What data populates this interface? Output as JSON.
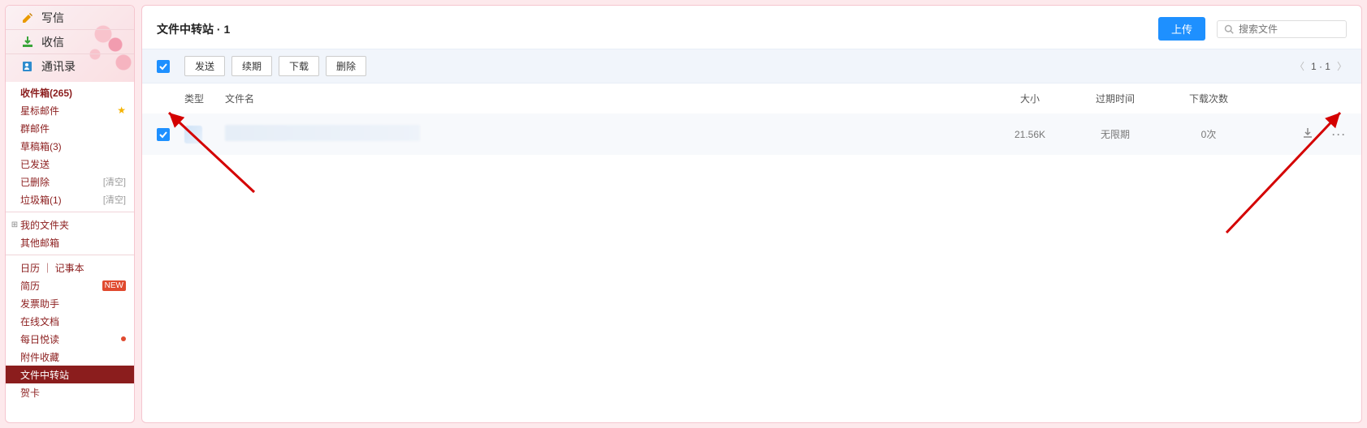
{
  "sidebar": {
    "top_items": [
      {
        "label": "写信",
        "icon": "compose-icon"
      },
      {
        "label": "收信",
        "icon": "inbox-icon"
      },
      {
        "label": "通讯录",
        "icon": "contacts-icon"
      }
    ],
    "nav_groups": [
      {
        "items": [
          {
            "label": "收件箱(265)",
            "bold": true
          },
          {
            "label": "星标邮件",
            "star": true
          },
          {
            "label": "群邮件"
          },
          {
            "label": "草稿箱(3)"
          },
          {
            "label": "已发送"
          },
          {
            "label": "已删除",
            "extra": "[清空]"
          },
          {
            "label": "垃圾箱(1)",
            "extra": "[清空]"
          }
        ]
      },
      {
        "items": [
          {
            "label": "我的文件夹",
            "expander": true
          },
          {
            "label": "其他邮箱"
          }
        ]
      },
      {
        "items": [
          {
            "label": "日历 ｜ 记事本"
          },
          {
            "label": "简历",
            "newbadge": "NEW"
          },
          {
            "label": "发票助手"
          },
          {
            "label": "在线文档"
          },
          {
            "label": "每日悦读",
            "dot": true
          },
          {
            "label": "附件收藏"
          },
          {
            "label": "文件中转站",
            "current": true
          },
          {
            "label": "贺卡"
          }
        ]
      }
    ]
  },
  "header": {
    "title": "文件中转站 · 1",
    "upload_label": "上传",
    "search_placeholder": "搜索文件"
  },
  "toolbar": {
    "buttons": [
      "发送",
      "续期",
      "下载",
      "删除"
    ],
    "pager": "1 · 1"
  },
  "columns": {
    "type": "类型",
    "name": "文件名",
    "size": "大小",
    "expire": "过期时间",
    "download_count": "下载次数"
  },
  "rows": [
    {
      "size": "21.56K",
      "expire": "无限期",
      "download_count": "0次"
    }
  ]
}
